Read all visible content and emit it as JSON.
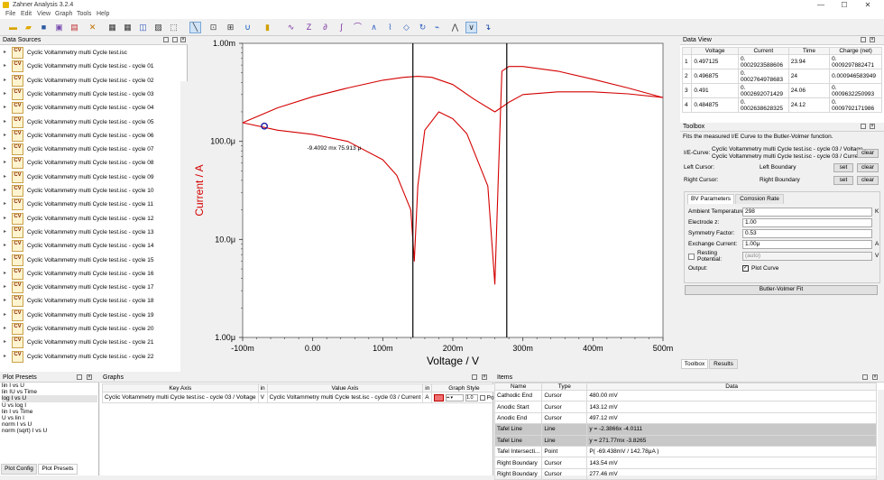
{
  "window": {
    "title": "Zahner Analysis 3.2.4",
    "minimize": "—",
    "maximize": "☐",
    "close": "✕"
  },
  "menu": [
    "File",
    "Edit",
    "View",
    "Graph",
    "Tools",
    "Help"
  ],
  "data_sources": {
    "title": "Data Sources",
    "icon_text": "CV",
    "items": [
      "Cyclic Voltammetry multi Cycle test.isc",
      "Cyclic Voltammetry multi Cycle test.isc - cycle 01",
      "Cyclic Voltammetry multi Cycle test.isc - cycle 02",
      "Cyclic Voltammetry multi Cycle test.isc - cycle 03",
      "Cyclic Voltammetry multi Cycle test.isc - cycle 04",
      "Cyclic Voltammetry multi Cycle test.isc - cycle 05",
      "Cyclic Voltammetry multi Cycle test.isc - cycle 06",
      "Cyclic Voltammetry multi Cycle test.isc - cycle 07",
      "Cyclic Voltammetry multi Cycle test.isc - cycle 08",
      "Cyclic Voltammetry multi Cycle test.isc - cycle 09",
      "Cyclic Voltammetry multi Cycle test.isc - cycle 10",
      "Cyclic Voltammetry multi Cycle test.isc - cycle 11",
      "Cyclic Voltammetry multi Cycle test.isc - cycle 12",
      "Cyclic Voltammetry multi Cycle test.isc - cycle 13",
      "Cyclic Voltammetry multi Cycle test.isc - cycle 14",
      "Cyclic Voltammetry multi Cycle test.isc - cycle 15",
      "Cyclic Voltammetry multi Cycle test.isc - cycle 16",
      "Cyclic Voltammetry multi Cycle test.isc - cycle 17",
      "Cyclic Voltammetry multi Cycle test.isc - cycle 18",
      "Cyclic Voltammetry multi Cycle test.isc - cycle 19",
      "Cyclic Voltammetry multi Cycle test.isc - cycle 20",
      "Cyclic Voltammetry multi Cycle test.isc - cycle 21",
      "Cyclic Voltammetry multi Cycle test.isc - cycle 22"
    ]
  },
  "chart_data": {
    "type": "line",
    "xlabel": "Voltage / V",
    "ylabel": "Current / A",
    "x_ticks": [
      "-100m",
      "0.00",
      "100m",
      "200m",
      "300m",
      "400m",
      "500m"
    ],
    "x_tick_values": [
      -0.1,
      0.0,
      0.1,
      0.2,
      0.3,
      0.4,
      0.5
    ],
    "y_ticks": [
      "1.00m",
      "100.0μ",
      "10.0μ",
      "1.00μ"
    ],
    "y_tick_values": [
      0.001,
      0.0001,
      1e-05,
      1e-06
    ],
    "xlim": [
      -0.1,
      0.5
    ],
    "ylog": true,
    "ylim": [
      1e-06,
      0.001
    ],
    "series": [
      {
        "color": "#d40000",
        "x": [
          -0.1,
          -0.05,
          0.0,
          0.05,
          0.1,
          0.13,
          0.15,
          0.17,
          0.2,
          0.23,
          0.26,
          0.28,
          0.3,
          0.35,
          0.4,
          0.45,
          0.5
        ],
        "y": [
          0.000155,
          0.00022,
          0.000285,
          0.00035,
          0.00042,
          0.00045,
          0.00046,
          0.00045,
          0.00038,
          0.00027,
          0.0002,
          0.00025,
          0.0003,
          0.00032,
          0.00032,
          0.000305,
          0.00028
        ]
      },
      {
        "color": "#d40000",
        "x": [
          0.5,
          0.45,
          0.4,
          0.35,
          0.3,
          0.28,
          0.27,
          0.265,
          0.26,
          0.25,
          0.22,
          0.2,
          0.18,
          0.16,
          0.15,
          0.145,
          0.14,
          0.12,
          0.1,
          0.05,
          0.0,
          -0.05,
          -0.1
        ],
        "y": [
          0.00028,
          0.00035,
          0.00043,
          0.00052,
          0.00058,
          0.00058,
          0.00052,
          4.5e-05,
          3.5e-06,
          3.5e-05,
          0.00012,
          0.00017,
          0.0002,
          0.00013,
          3.5e-05,
          6e-06,
          2e-05,
          4.5e-05,
          6.5e-05,
          0.0001,
          0.000118,
          0.00013,
          0.000155
        ]
      }
    ],
    "cursors_x": [
      0.143,
      0.277
    ],
    "marker": {
      "x": -0.069,
      "y": 0.000143
    },
    "annotation": "-9.4092 mx 75.913 μ",
    "annotation_pos": {
      "x": -0.008,
      "y": 8.2e-05
    }
  },
  "data_view": {
    "title": "Data View",
    "columns": [
      "",
      "Voltage",
      "Current",
      "Time",
      "Charge (net)"
    ],
    "rows": [
      [
        "1",
        "0.497125",
        "0.\n0002923588606",
        "23.94",
        "0.\n0009297882471"
      ],
      [
        "2",
        "0.496875",
        "0.\n0002764978683",
        "24",
        "0.000946583949"
      ],
      [
        "3",
        "0.491",
        "0.\n0002692071429",
        "24.06",
        "0.\n0009632250993"
      ],
      [
        "4",
        "0.484875",
        "0.\n0002638628325",
        "24.12",
        "0.\n0009792171986"
      ]
    ]
  },
  "toolbox": {
    "title": "Toolbox",
    "description": "Fits the measured I/E Curve to the Butler-Volmer function.",
    "ie_curve_label": "I/E-Curve:",
    "ie_curve_value1": "Cyclic Voltammetry multi Cycle test.isc - cycle 03 / Voltage",
    "ie_curve_value2": "Cyclic Voltammetry multi Cycle test.isc - cycle 03 / Current",
    "left_cursor_label": "Left Cursor:",
    "left_cursor_value": "Left Boundary",
    "right_cursor_label": "Right Cursor:",
    "right_cursor_value": "Right Boundary",
    "clear": "clear",
    "set": "set",
    "tabs": [
      "BV Parameters",
      "Corrosion Rate"
    ],
    "params": [
      {
        "label": "Ambient Temperature:",
        "value": "298",
        "unit": "K"
      },
      {
        "label": "Electrode z:",
        "value": "1.00",
        "unit": ""
      },
      {
        "label": "Symmetry Factor:",
        "value": "0.53",
        "unit": ""
      },
      {
        "label": "Exchange Current:",
        "value": "1.00μ",
        "unit": "A"
      }
    ],
    "resting_label": "Resting\nPotential:",
    "resting_value": "(auto)",
    "resting_unit": "V",
    "output_label": "Output:",
    "plot_curve_label": "Plot Curve",
    "fit_button": "Butler-Volmer Fit",
    "bottom_tabs": [
      "Toolbox",
      "Results"
    ]
  },
  "plot_presets": {
    "title": "Plot Presets",
    "items": [
      "lin I vs U",
      "lin IU vs Time",
      "log I vs U",
      "U vs log I",
      "lin I vs Time",
      "U vs lin I",
      "norm I vs U",
      "norm (sqrt) I vs U"
    ],
    "tabs": [
      "Plot Config",
      "Plot Presets"
    ]
  },
  "graphs": {
    "title": "Graphs",
    "columns": [
      "Key Axis",
      "in",
      "Value Axis",
      "in",
      "Graph Style"
    ],
    "row": [
      "Cyclic Voltammetry multi Cycle test.isc - cycle 03 / Voltage",
      "V",
      "Cyclic Voltammetry multi Cycle test.isc - cycle 03 / Current",
      "A"
    ],
    "style_width": "1.0",
    "style_po": "Po"
  },
  "items_panel": {
    "title": "Items",
    "columns": [
      "Name",
      "Type",
      "Data"
    ],
    "rows": [
      [
        "Cathodic End",
        "Cursor",
        "480.00 mV"
      ],
      [
        "Anodic Start",
        "Cursor",
        "143.12 mV"
      ],
      [
        "Anodic End",
        "Cursor",
        "497.12 mV"
      ],
      [
        "Tafel Line",
        "Line",
        "y = -2.3866x -4.0111"
      ],
      [
        "Tafel Line",
        "Line",
        "y = 271.77mx -3.8265"
      ],
      [
        "Tafel Intersecti...",
        "Point",
        "P( -69.438mV / 142.78μA )"
      ],
      [
        "Right Boundary",
        "Cursor",
        "143.54 mV"
      ],
      [
        "Right Boundary",
        "Cursor",
        "277.46 mV"
      ]
    ]
  }
}
